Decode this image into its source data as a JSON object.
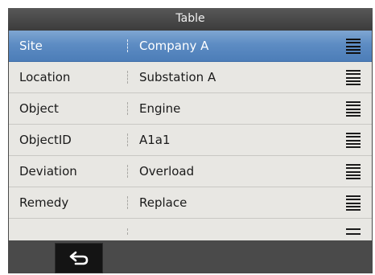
{
  "window": {
    "title": "Table"
  },
  "table": {
    "rows": [
      {
        "label": "Site",
        "value": "Company A",
        "selected": true,
        "icon": "menu-lines-icon"
      },
      {
        "label": "Location",
        "value": "Substation A",
        "selected": false,
        "icon": "menu-lines-icon"
      },
      {
        "label": "Object",
        "value": "Engine",
        "selected": false,
        "icon": "menu-lines-icon"
      },
      {
        "label": "ObjectID",
        "value": "A1a1",
        "selected": false,
        "icon": "menu-lines-icon"
      },
      {
        "label": "Deviation",
        "value": "Overload",
        "selected": false,
        "icon": "menu-lines-icon"
      },
      {
        "label": "Remedy",
        "value": "Replace",
        "selected": false,
        "icon": "menu-lines-icon"
      }
    ]
  },
  "footer": {
    "back_icon": "back-arrow-icon"
  },
  "colors": {
    "selection": "#5d8cc3",
    "table_background": "#e8e7e3",
    "chrome": "#4a4a4a"
  }
}
